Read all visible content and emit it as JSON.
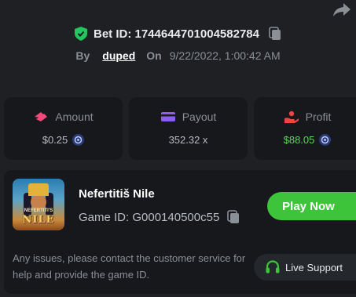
{
  "bet": {
    "id_label": "Bet ID: 1744644701004582784",
    "by_label": "By",
    "user": "duped",
    "on_label": "On",
    "date": "9/22/2022, 1:00:42 AM"
  },
  "stats": {
    "amount": {
      "label": "Amount",
      "value": "$0.25"
    },
    "payout": {
      "label": "Payout",
      "value": "352.32 x"
    },
    "profit": {
      "label": "Profit",
      "value": "$88.05"
    }
  },
  "game": {
    "title": "Nefertitiš Nile",
    "id_label": "Game ID: G000140500c55",
    "thumb_sub": "NEFERTITI'S",
    "thumb_logo": "NILE",
    "play_label": "Play Now"
  },
  "support": {
    "issue_text": "Any issues, please contact the customer service for help and provide the game ID.",
    "button_label": "Live Support"
  },
  "colors": {
    "background": "#1e2023",
    "card": "#16181b",
    "accent_green": "#3ec43a",
    "profit_green": "#5ed55b",
    "shield_green": "#22c55e",
    "amount_pink": "#f0497a",
    "payout_purple": "#8b5cf6",
    "profit_red": "#ef4444"
  },
  "icons": [
    "share-icon",
    "shield-check-icon",
    "copy-icon",
    "amount-icon",
    "payout-card-icon",
    "profit-hand-icon",
    "coin-icon",
    "headset-icon"
  ]
}
